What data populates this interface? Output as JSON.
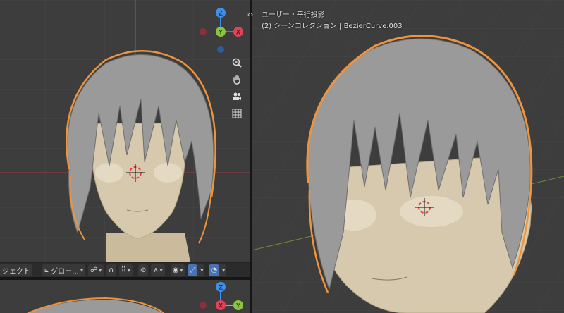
{
  "right_viewport": {
    "view_name": "ユーザー・平行投影",
    "collection_line": "(2) シーンコレクション | BezierCurve.003"
  },
  "left_header": {
    "mode_label": "ジェクト",
    "orientation_label": "グロー…"
  },
  "gizmo": {
    "z_label": "Z",
    "y_label": "Y",
    "x_label": "X"
  },
  "nav_icons": [
    "zoom-icon",
    "hand-pan-icon",
    "camera-icon",
    "grid-icon"
  ],
  "colors": {
    "viewport_bg": "#3d3d3d",
    "selection_orange": "#f0943c",
    "axis_x": "#e3405a",
    "axis_y": "#8bc53f",
    "axis_z": "#3f8ee8",
    "skin": "#d6c9ad",
    "hair": "#9a9a9a"
  }
}
